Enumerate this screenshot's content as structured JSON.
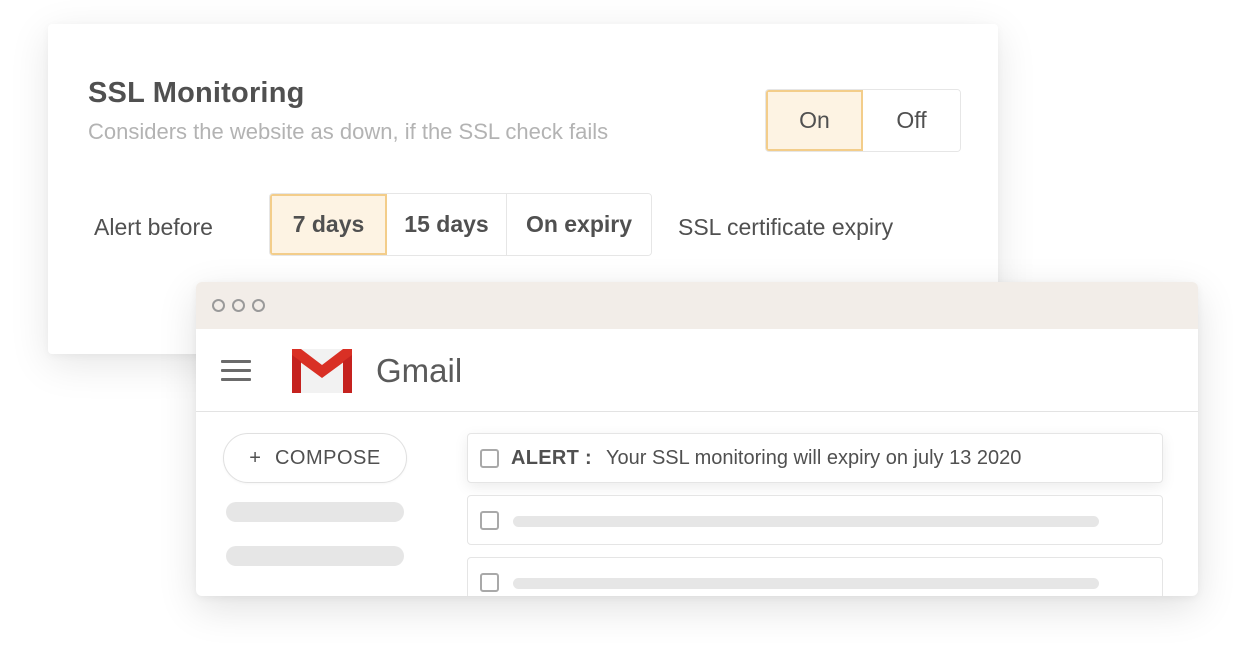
{
  "ssl": {
    "title": "SSL Monitoring",
    "description": "Considers the website as down, if the SSL check fails",
    "toggle": {
      "on_label": "On",
      "off_label": "Off",
      "selected": "On"
    },
    "alert_label": "Alert before",
    "alert_options": [
      "7 days",
      "15 days",
      "On expiry"
    ],
    "alert_selected": "7 days",
    "expiry_label": "SSL certificate expiry"
  },
  "gmail": {
    "app_name": "Gmail",
    "compose_plus": "+",
    "compose_label": "COMPOSE",
    "alert_email": {
      "tag": "ALERT :",
      "message": "Your SSL monitoring will expiry on july 13 2020"
    }
  },
  "colors": {
    "accent_bg": "#fdf3e3",
    "accent_border": "#f3cd8a",
    "titlebar": "#f2ede8",
    "gmail_red": "#d93025"
  }
}
